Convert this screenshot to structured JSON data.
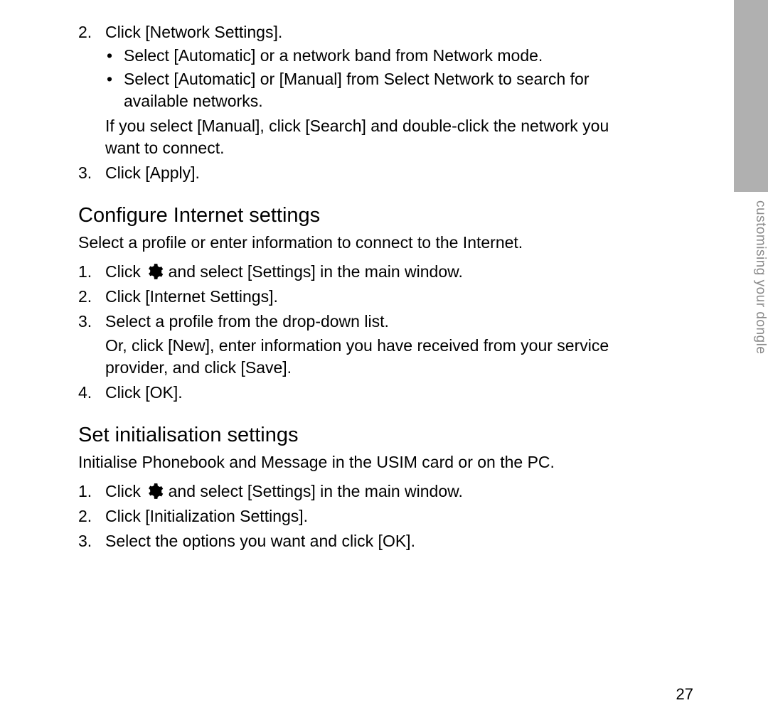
{
  "topList": {
    "item2": "Click [Network Settings].",
    "bullets": [
      "Select [Automatic] or a network band from Network mode.",
      "Select [Automatic] or [Manual] from Select Network to search for available networks."
    ],
    "subtext": "If you select [Manual], click [Search] and double-click the network you want to connect.",
    "item3": "Click [Apply]."
  },
  "section1": {
    "heading": "Configure Internet settings",
    "intro": "Select a profile or enter information to connect to the Internet.",
    "steps": {
      "s1_prefix": "Click ",
      "s1_suffix": " and select [Settings] in the main window.",
      "s2": "Click [Internet Settings].",
      "s3": "Select a profile from the drop-down list.",
      "s3_sub": "Or, click [New], enter information you have received from your service provider, and click [Save].",
      "s4": "Click [OK]."
    }
  },
  "section2": {
    "heading": "Set initialisation settings",
    "intro": "Initialise Phonebook and Message in the USIM card or on the PC.",
    "steps": {
      "s1_prefix": "Click ",
      "s1_suffix": " and select [Settings] in the main window.",
      "s2": "Click [Initialization Settings].",
      "s3": "Select the options you want and click [OK]."
    }
  },
  "sideTab": "customising your dongle",
  "pageNumber": "27"
}
